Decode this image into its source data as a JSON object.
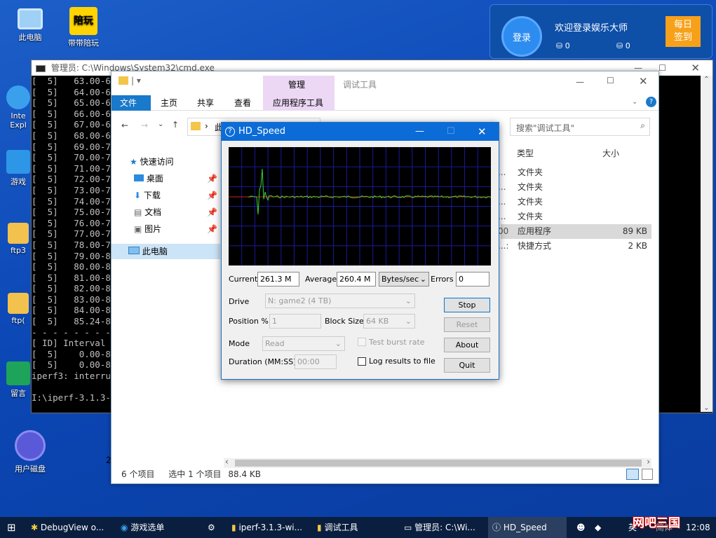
{
  "desktop": {
    "icons": [
      {
        "label": "此电脑"
      },
      {
        "label": "带带陪玩",
        "badge": "陪玩"
      },
      {
        "label": "Inte"
      },
      {
        "label": "Expl"
      },
      {
        "label": "游戏"
      },
      {
        "label": "ftp3"
      },
      {
        "label": "ftp("
      },
      {
        "label": "留言"
      },
      {
        "label": "用户磁盘"
      }
    ]
  },
  "login_widget": {
    "button": "登录",
    "welcome": "欢迎登录娱乐大师",
    "sign_line1": "每日",
    "sign_line2": "签到",
    "coin1": "0",
    "coin2": "0"
  },
  "cmd": {
    "title": "管理员: C:\\Windows\\System32\\cmd.exe",
    "lines": [
      "[  5]   63.00-64",
      "[  5]   64.00-65",
      "[  5]   65.00-66",
      "[  5]   66.00-67",
      "[  5]   67.00-68",
      "[  5]   68.00-69",
      "[  5]   69.00-70",
      "[  5]   70.00-71",
      "[  5]   71.00-72",
      "[  5]   72.00-73",
      "[  5]   73.00-74",
      "[  5]   74.00-75",
      "[  5]   75.00-76",
      "[  5]   76.00-77",
      "[  5]   77.00-78",
      "[  5]   78.00-79",
      "[  5]   79.00-80",
      "[  5]   80.00-81",
      "[  5]   81.00-82",
      "[  5]   82.00-83",
      "[  5]   83.00-84",
      "[  5]   84.00-85",
      "[  5]   85.24-85",
      "- - - - - - - -",
      "[ ID] Interval",
      "[  5]    0.00-85",
      "[  5]    0.00-85",
      "iperf3: interru",
      "",
      "I:\\iperf-3.1.3-"
    ]
  },
  "explorer": {
    "ribbon_tabs": [
      "文件",
      "主页",
      "共享",
      "查看"
    ],
    "manage_tab": "管理",
    "app_tools": "应用程序工具",
    "window_title": "调试工具",
    "addr_crumb": "此",
    "search_placeholder": "搜索\"调试工具\"",
    "nav": {
      "quick_access": "快速访问",
      "items": [
        "桌面",
        "下载",
        "文档",
        "图片"
      ],
      "this_pc": "此电脑"
    },
    "columns": {
      "type": "类型",
      "size": "大小"
    },
    "files": [
      {
        "type": "文件夹",
        "size": ""
      },
      {
        "type": "文件夹",
        "size": ""
      },
      {
        "type": "文件夹",
        "size": ""
      },
      {
        "type": "文件夹",
        "size": ""
      },
      {
        "type": "应用程序",
        "size": "89 KB"
      },
      {
        "type": "快捷方式",
        "size": "2 KB"
      }
    ],
    "row_prefix": [
      "...",
      "...",
      "...",
      "...",
      "00",
      "...:"
    ],
    "status": {
      "count": "6 个项目",
      "selected": "选中 1 个项目",
      "size": "88.4 KB"
    },
    "left_num": "2"
  },
  "hd_speed": {
    "title": "HD_Speed",
    "current_label": "Current",
    "current_value": "261.3 M",
    "average_label": "Average",
    "average_value": "260.4 M",
    "unit": "Bytes/sec",
    "errors_label": "Errors",
    "errors_value": "0",
    "drive_label": "Drive",
    "drive_value": "N: game2 (4 TB)",
    "position_label": "Position %",
    "position_value": "1",
    "block_label": "Block Size",
    "block_value": "64 KB",
    "mode_label": "Mode",
    "mode_value": "Read",
    "burst_label": "Test burst rate",
    "duration_label": "Duration (MM:SS)",
    "duration_value": "00:00",
    "log_label": "Log results to file",
    "btn_stop": "Stop",
    "btn_reset": "Reset",
    "btn_about": "About",
    "btn_quit": "Quit",
    "graph": {
      "line_color": "#39d439",
      "ref_color": "#d42020",
      "grid_color": "#1a1a99"
    }
  },
  "taskbar": {
    "items": [
      "DebugView o...",
      "游戏选单",
      "iperf-3.1.3-wi...",
      "调试工具",
      "管理员: C:\\Wi...",
      "HD_Speed"
    ],
    "tray_lang": "英",
    "tray_time": "12:08",
    "watermark": "网吧三国",
    "tray_text": "简体"
  }
}
